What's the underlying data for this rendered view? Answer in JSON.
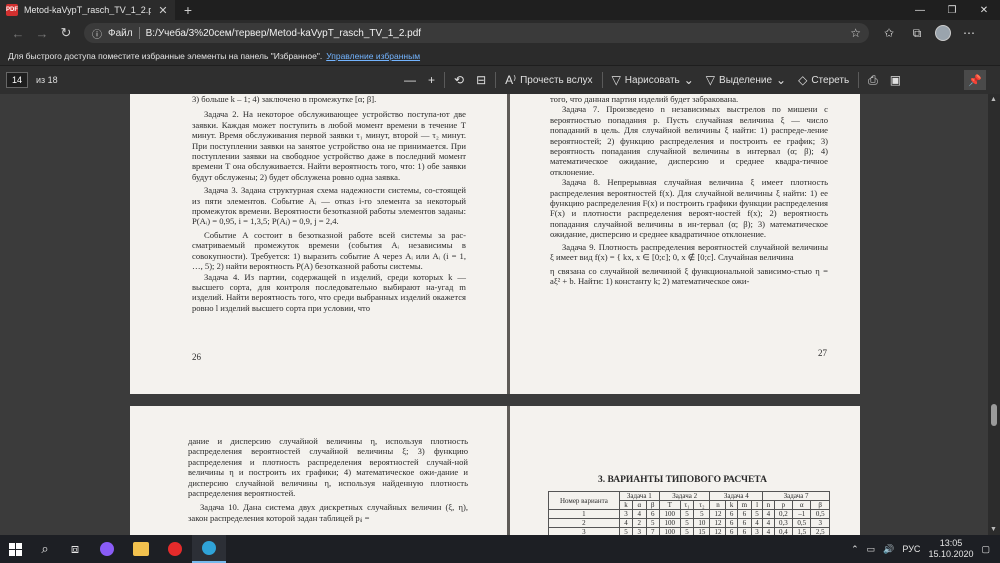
{
  "tab": {
    "title": "Metod-kaVypT_rasch_TV_1_2.pdf",
    "badge": "PDF"
  },
  "address": {
    "file_label": "Файл",
    "url": "B:/Учеба/3%20сем/тервер/Metod-kaVypT_rasch_TV_1_2.pdf"
  },
  "favorites_bar": {
    "hint": "Для быстрого доступа поместите избранные элементы на панель \"Избранное\".",
    "link": "Управление избранным"
  },
  "pdf_toolbar": {
    "page_number": "14",
    "page_total": "из 18",
    "read_aloud": "Прочесть вслух",
    "draw": "Нарисовать",
    "highlight": "Выделение",
    "erase": "Стереть"
  },
  "document": {
    "page26": {
      "lines": [
        "3) больше k – 1; 4) заключено в промежутке [α; β].",
        "Задача 2. На некоторое обслуживающее устройство поступа-ют две заявки. Каждая может поступить в любой момент времени в течение T минут. Время обслуживания первой заявки τ₁ минут, второй — τ₂ минут. При поступлении заявки на занятое устройство она не принимается. При поступлении заявки на свободное устройство даже в последний момент времени T она обслуживается. Найти вероятность того, что: 1) обе заявки будут обслужены; 2) будет обслужена ровно одна заявка.",
        "Задача 3. Задана структурная схема надежности системы, со-стоящей из пяти элементов. Событие Aᵢ — отказ i-го элемента за некоторый промежуток времени. Вероятности безотказной работы элементов заданы: P(Aᵢ) = 0,95, i = 1,3,5; P(Aⱼ) = 0,9, j = 2,4.",
        "Событие A состоит в безотказной работе всей системы за рас-сматриваемый промежуток времени (события Aᵢ независимы в совокупности). Требуется: 1) выразить событие A через Aᵢ или Aᵢ (i = 1, …, 5); 2) найти вероятность P(A) безотказной работы системы.",
        "Задача 4. Из партии, содержащей n изделий, среди которых k — высшего сорта, для контроля последовательно выбирают на-угад m изделий. Найти вероятность того, что среди выбранных изделий окажется ровно l изделий высшего сорта при условии, что"
      ],
      "page_label": "26"
    },
    "page27": {
      "lines": [
        "того, что данная партия изделий будет забракована.",
        "Задача 7. Произведено n независимых выстрелов по мишени с вероятностью попадания p. Пусть случайная величина ξ — число попаданий в цель. Для случайной величины ξ найти: 1) распреде-ление вероятностей; 2) функцию распределения и построить ее график; 3) вероятность попадания случайной величины в интервал (α; β); 4) математическое ожидание, дисперсию и среднее квадра-тичное отклонение.",
        "Задача 8. Непрерывная случайная величина ξ имеет плотность распределения вероятностей f(x). Для случайной величины ξ найти: 1) ее функцию распределения F(x) и построить графики функции распределения F(x) и плотности распределения вероят-ностей f(x); 2) вероятность попадания случайной величины в ин-тервал (α; β); 3) математическое ожидание, дисперсию и среднее квадратичное отклонение.",
        "Задача 9. Плотность распределения вероятностей случайной величины ξ имеет вид f(x) = { kx, x ∈ [0;c]; 0, x ∉ [0;c]. Случайная величина",
        "η связана со случайной величиной ξ функциональной зависимо-стью η = aξ² + b. Найти: 1) константу k; 2) математическое ожи-"
      ],
      "page_label": "27"
    },
    "page28": {
      "lines": [
        "дание и дисперсию случайной величины η, используя плотность распределения вероятностей случайной величины ξ; 3) функцию распределения и плотность распределения вероятностей случай-ной величины η и построить их графики; 4) математическое ожи-дание и дисперсию случайной величины η, используя найденную плотность распределения вероятностей.",
        "Задача 10. Дана система двух дискретных случайных величин (ξ, η), закон распределения которой задан таблицей pᵢⱼ ="
      ]
    },
    "page29": {
      "heading": "3. ВАРИАНТЫ ТИПОВОГО РАСЧЕТА",
      "table": {
        "group_headers": [
          "Номер варианта",
          "Задача 1",
          "Задача 2",
          "Задача 4",
          "Задача 7"
        ],
        "sub_headers": [
          "k",
          "α",
          "β",
          "T",
          "τ₁",
          "τ₂",
          "n",
          "k",
          "m",
          "l",
          "n",
          "p",
          "α",
          "β"
        ],
        "rows": [
          [
            "1",
            "3",
            "4",
            "6",
            "100",
            "5",
            "5",
            "12",
            "6",
            "6",
            "5",
            "4",
            "0,2",
            "–1",
            "0,5"
          ],
          [
            "2",
            "4",
            "2",
            "5",
            "100",
            "5",
            "10",
            "12",
            "6",
            "6",
            "4",
            "4",
            "0,3",
            "0,5",
            "3"
          ],
          [
            "3",
            "5",
            "3",
            "7",
            "100",
            "5",
            "15",
            "12",
            "6",
            "6",
            "3",
            "4",
            "0,4",
            "1,5",
            "2,5"
          ]
        ]
      }
    }
  },
  "taskbar": {
    "lang": "РУС",
    "time": "13:05",
    "date": "15.10.2020"
  }
}
